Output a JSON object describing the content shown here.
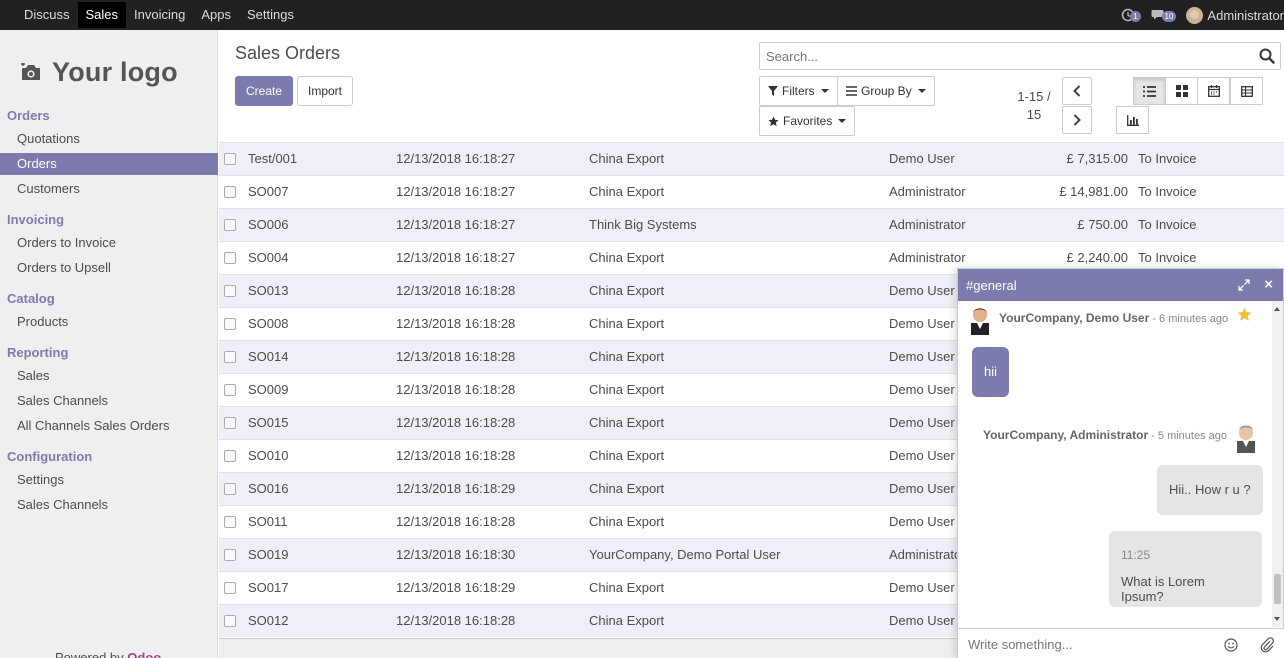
{
  "topbar": {
    "menu": [
      {
        "label": "Discuss",
        "active": false
      },
      {
        "label": "Sales",
        "active": true
      },
      {
        "label": "Invoicing",
        "active": false
      },
      {
        "label": "Apps",
        "active": false
      },
      {
        "label": "Settings",
        "active": false
      }
    ],
    "activity_count": "1",
    "messages_count": "10",
    "user_name": "Administrator"
  },
  "sidebar": {
    "logo_text": "Your logo",
    "sections": [
      {
        "title": "Orders",
        "items": [
          {
            "label": "Quotations"
          },
          {
            "label": "Orders",
            "active": true
          },
          {
            "label": "Customers"
          }
        ]
      },
      {
        "title": "Invoicing",
        "items": [
          {
            "label": "Orders to Invoice"
          },
          {
            "label": "Orders to Upsell"
          }
        ]
      },
      {
        "title": "Catalog",
        "items": [
          {
            "label": "Products"
          }
        ]
      },
      {
        "title": "Reporting",
        "items": [
          {
            "label": "Sales"
          },
          {
            "label": "Sales Channels"
          },
          {
            "label": "All Channels Sales Orders"
          }
        ]
      },
      {
        "title": "Configuration",
        "items": [
          {
            "label": "Settings"
          },
          {
            "label": "Sales Channels"
          }
        ]
      }
    ],
    "powered_prefix": "Powered by ",
    "powered_brand": "Odoo"
  },
  "control_panel": {
    "title": "Sales Orders",
    "create_label": "Create",
    "import_label": "Import",
    "search_placeholder": "Search...",
    "filters_label": "Filters",
    "groupby_label": "Group By",
    "favorites_label": "Favorites",
    "pager_range": "1-15 /",
    "pager_total": "15"
  },
  "orders": [
    {
      "number": "Test/001",
      "date": "12/13/2018 16:18:27",
      "customer": "China Export",
      "salesperson": "Demo User",
      "amount": "£ 7,315.00",
      "status": "To Invoice"
    },
    {
      "number": "SO007",
      "date": "12/13/2018 16:18:27",
      "customer": "China Export",
      "salesperson": "Administrator",
      "amount": "£ 14,981.00",
      "status": "To Invoice"
    },
    {
      "number": "SO006",
      "date": "12/13/2018 16:18:27",
      "customer": "Think Big Systems",
      "salesperson": "Administrator",
      "amount": "£ 750.00",
      "status": "To Invoice"
    },
    {
      "number": "SO004",
      "date": "12/13/2018 16:18:27",
      "customer": "China Export",
      "salesperson": "Administrator",
      "amount": "£ 2,240.00",
      "status": "To Invoice"
    },
    {
      "number": "SO013",
      "date": "12/13/2018 16:18:28",
      "customer": "China Export",
      "salesperson": "Demo User",
      "amount": "",
      "status": ""
    },
    {
      "number": "SO008",
      "date": "12/13/2018 16:18:28",
      "customer": "China Export",
      "salesperson": "Demo User",
      "amount": "",
      "status": ""
    },
    {
      "number": "SO014",
      "date": "12/13/2018 16:18:28",
      "customer": "China Export",
      "salesperson": "Demo User",
      "amount": "",
      "status": ""
    },
    {
      "number": "SO009",
      "date": "12/13/2018 16:18:28",
      "customer": "China Export",
      "salesperson": "Demo User",
      "amount": "",
      "status": ""
    },
    {
      "number": "SO015",
      "date": "12/13/2018 16:18:28",
      "customer": "China Export",
      "salesperson": "Demo User",
      "amount": "",
      "status": ""
    },
    {
      "number": "SO010",
      "date": "12/13/2018 16:18:28",
      "customer": "China Export",
      "salesperson": "Demo User",
      "amount": "",
      "status": ""
    },
    {
      "number": "SO016",
      "date": "12/13/2018 16:18:29",
      "customer": "China Export",
      "salesperson": "Demo User",
      "amount": "",
      "status": ""
    },
    {
      "number": "SO011",
      "date": "12/13/2018 16:18:28",
      "customer": "China Export",
      "salesperson": "Demo User",
      "amount": "",
      "status": ""
    },
    {
      "number": "SO019",
      "date": "12/13/2018 16:18:30",
      "customer": "YourCompany, Demo Portal User",
      "salesperson": "Administrator",
      "amount": "",
      "status": ""
    },
    {
      "number": "SO017",
      "date": "12/13/2018 16:18:29",
      "customer": "China Export",
      "salesperson": "Demo User",
      "amount": "",
      "status": ""
    },
    {
      "number": "SO012",
      "date": "12/13/2018 16:18:28",
      "customer": "China Export",
      "salesperson": "Demo User",
      "amount": "",
      "status": ""
    }
  ],
  "chat": {
    "channel": "#general",
    "messages": [
      {
        "author": "YourCompany, Demo User",
        "time": " - 6 minutes ago",
        "text": "hii"
      },
      {
        "author": "YourCompany, Administrator",
        "time": " - 5 minutes ago",
        "text": "Hii.. How r u ?"
      },
      {
        "stamp": "11:25",
        "text": "What is Lorem Ipsum?"
      }
    ],
    "input_placeholder": "Write something..."
  },
  "colors": {
    "brand": "#7c7bad",
    "navbar": "#212121",
    "sidebar_bg": "#f0eeee",
    "row_stripe": "#efeff8"
  }
}
